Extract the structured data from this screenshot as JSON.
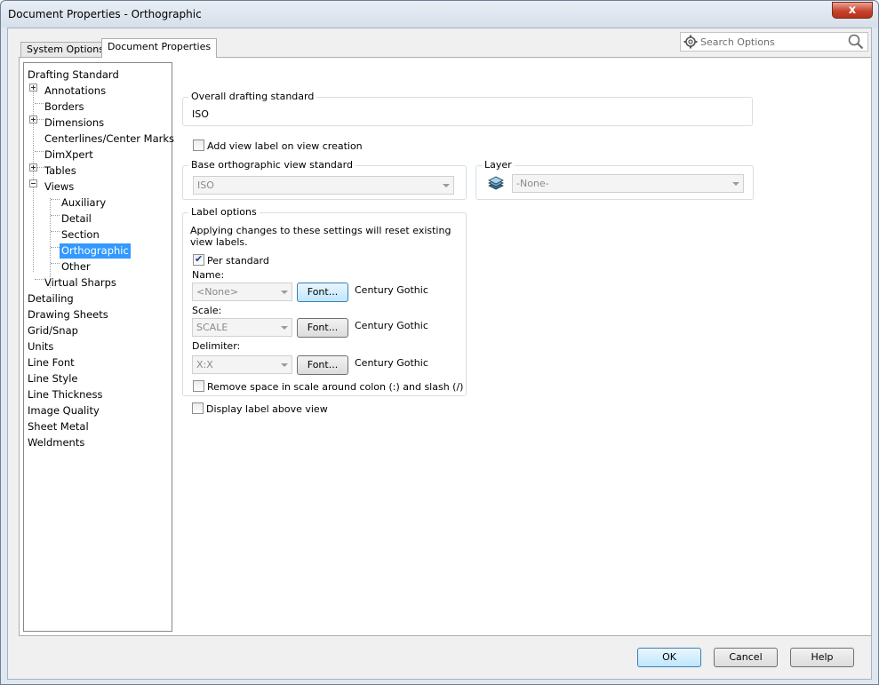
{
  "window": {
    "title": "Document Properties - Orthographic",
    "close_glyph": "x"
  },
  "tabs": {
    "system": "System Options",
    "document": "Document Properties"
  },
  "search": {
    "placeholder": "Search Options"
  },
  "tree": {
    "items": [
      {
        "label": "Drafting Standard"
      },
      {
        "label": "Annotations"
      },
      {
        "label": "Borders"
      },
      {
        "label": "Dimensions"
      },
      {
        "label": "Centerlines/Center Marks"
      },
      {
        "label": "DimXpert"
      },
      {
        "label": "Tables"
      },
      {
        "label": "Views"
      },
      {
        "label": "Auxiliary"
      },
      {
        "label": "Detail"
      },
      {
        "label": "Section"
      },
      {
        "label": "Orthographic"
      },
      {
        "label": "Other"
      },
      {
        "label": "Virtual Sharps"
      },
      {
        "label": "Detailing"
      },
      {
        "label": "Drawing Sheets"
      },
      {
        "label": "Grid/Snap"
      },
      {
        "label": "Units"
      },
      {
        "label": "Line Font"
      },
      {
        "label": "Line Style"
      },
      {
        "label": "Line Thickness"
      },
      {
        "label": "Image Quality"
      },
      {
        "label": "Sheet Metal"
      },
      {
        "label": "Weldments"
      }
    ]
  },
  "overall": {
    "label": "Overall drafting standard",
    "value": "ISO"
  },
  "add_view_label": {
    "label": "Add view label on view creation",
    "checked": false
  },
  "base_view": {
    "label": "Base orthographic view standard",
    "value": "ISO"
  },
  "layer": {
    "label": "Layer",
    "value": "-None-"
  },
  "label_options": {
    "title": "Label options",
    "note_line1": "Applying changes to these settings will reset existing",
    "note_line2": "view labels.",
    "per_standard": {
      "label": "Per standard",
      "checked": true
    },
    "name": {
      "label": "Name:",
      "value": "<None>",
      "font_button": "Font...",
      "font_name": "Century Gothic"
    },
    "scale": {
      "label": "Scale:",
      "value": "SCALE",
      "font_button": "Font...",
      "font_name": "Century Gothic"
    },
    "delimiter": {
      "label": "Delimiter:",
      "value": "X:X",
      "font_button": "Font...",
      "font_name": "Century Gothic"
    },
    "remove_space": {
      "label": "Remove space in scale around colon (:) and slash (/)",
      "checked": false
    }
  },
  "display_above": {
    "label": "Display label above view",
    "checked": false
  },
  "buttons": {
    "ok": "OK",
    "cancel": "Cancel",
    "help": "Help"
  },
  "colors": {
    "selection": "#3399ff",
    "close": "#c7432c"
  }
}
